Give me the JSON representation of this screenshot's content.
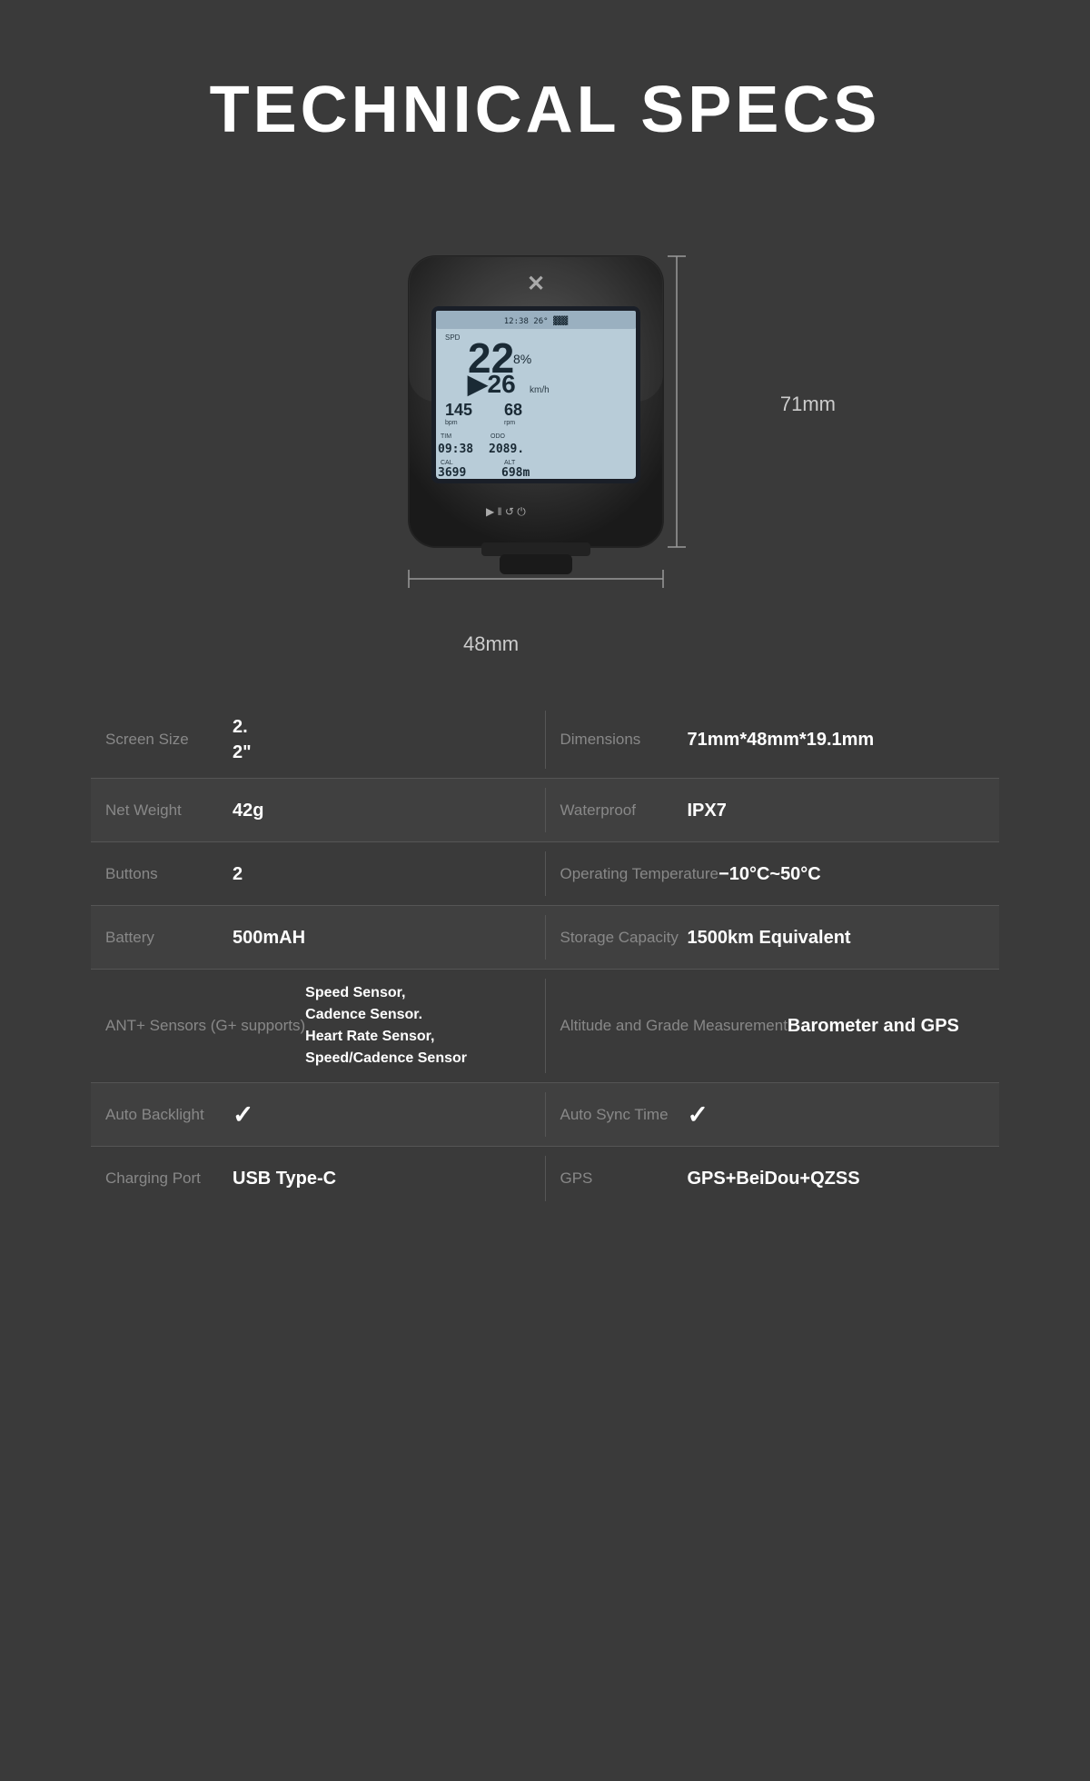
{
  "page": {
    "title": "TECHNICAL SPECS",
    "bg_color": "#3a3a3a"
  },
  "device": {
    "dim_vertical": "71mm",
    "dim_horizontal": "48mm"
  },
  "specs": [
    {
      "left_label": "Screen Size",
      "left_value": "2.2\"",
      "right_label": "Dimensions",
      "right_value": "71mm*48mm*19.1mm",
      "shaded": false
    },
    {
      "left_label": "Net Weight",
      "left_value": "42g",
      "right_label": "Waterproof",
      "right_value": "IPX7",
      "shaded": true
    },
    {
      "left_label": "Buttons",
      "left_value": "2",
      "right_label": "Operating Temperature",
      "right_value": "−10°C~50°C",
      "shaded": false
    },
    {
      "left_label": "Battery",
      "left_value": "500mAH",
      "right_label": "Storage Capacity",
      "right_value": "1500km Equivalent",
      "shaded": true
    },
    {
      "left_label": "ANT+ Sensors (G+ supports)",
      "left_value": "Speed Sensor, Cadence Sensor. Heart Rate Sensor, Speed/Cadence Sensor",
      "right_label": "Altitude and Grade Measurement",
      "right_value": "Barometer and GPS",
      "shaded": false
    },
    {
      "left_label": "Auto Backlight",
      "left_value": "✓",
      "right_label": "Auto Sync Time",
      "right_value": "✓",
      "shaded": true
    },
    {
      "left_label": "Charging Port",
      "left_value": "USB Type-C",
      "right_label": "GPS",
      "right_value": "GPS+BeiDou+QZSS",
      "shaded": false
    }
  ]
}
